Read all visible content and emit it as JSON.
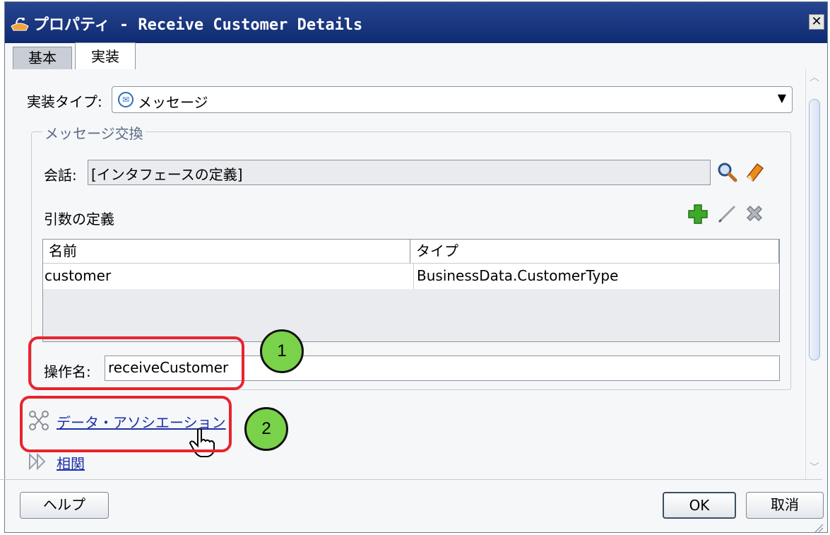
{
  "window": {
    "title": "プロパティ - Receive Customer Details",
    "close_glyph": "✕"
  },
  "tabs": [
    {
      "label": "基本",
      "selected": false
    },
    {
      "label": "実装",
      "selected": true
    }
  ],
  "impl_type": {
    "label": "実装タイプ:",
    "value": "メッセージ"
  },
  "message_exchange": {
    "group_title": "メッセージ交換",
    "conversation": {
      "label": "会話:",
      "value": "[インタフェースの定義]"
    },
    "arguments": {
      "title": "引数の定義",
      "columns": [
        "名前",
        "タイプ"
      ],
      "rows": [
        {
          "name": "customer",
          "type": "BusinessData.CustomerType"
        }
      ]
    },
    "operation": {
      "label": "操作名:",
      "value": "receiveCustomer"
    }
  },
  "links": {
    "data_association": "データ・アソシエーション",
    "correlation": "相関"
  },
  "callouts": [
    "1",
    "2"
  ],
  "buttons": {
    "help": "ヘルプ",
    "ok": "OK",
    "cancel": "取消"
  },
  "colors": {
    "title_bar": "#0e2b72",
    "highlight": "#e8242c",
    "callout": "#79d24a",
    "link": "#1b2fa8"
  }
}
